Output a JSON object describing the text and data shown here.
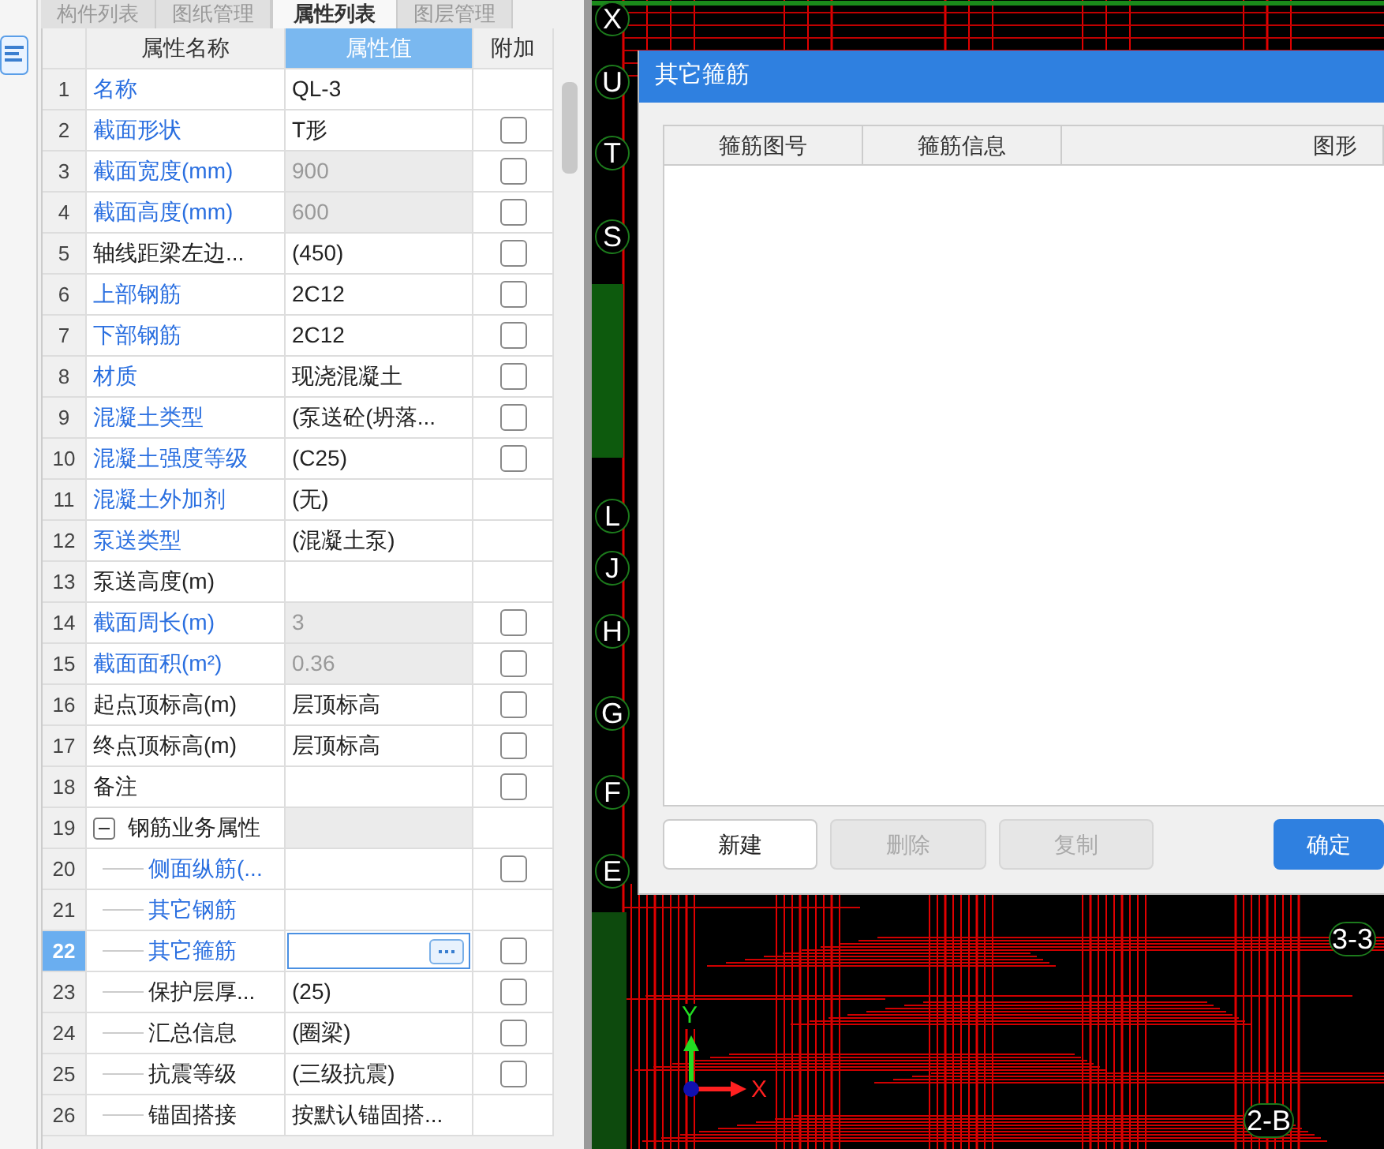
{
  "tabs": [
    {
      "label": "构件列表",
      "selected": false
    },
    {
      "label": "图纸管理",
      "selected": false
    },
    {
      "label": "属性列表",
      "selected": true
    },
    {
      "label": "图层管理",
      "selected": false
    }
  ],
  "property_table": {
    "columns": [
      "属性名称",
      "属性值",
      "附加"
    ],
    "rows": [
      {
        "num": "1",
        "name": "名称",
        "value": "QL-3",
        "link": true,
        "readonly": false,
        "selected": false
      },
      {
        "num": "2",
        "name": "截面形状",
        "value": "T形",
        "link": true,
        "readonly": false,
        "selected": false,
        "attached": false
      },
      {
        "num": "3",
        "name": "截面宽度(mm)",
        "value": "900",
        "link": true,
        "readonly": true,
        "selected": false,
        "attached": false
      },
      {
        "num": "4",
        "name": "截面高度(mm)",
        "value": "600",
        "link": true,
        "readonly": true,
        "selected": false,
        "attached": false
      },
      {
        "num": "5",
        "name": "轴线距梁左边...",
        "value": "(450)",
        "link": false,
        "readonly": false,
        "selected": false,
        "attached": false
      },
      {
        "num": "6",
        "name": "上部钢筋",
        "value": "2C12",
        "link": true,
        "readonly": false,
        "selected": false,
        "attached": false
      },
      {
        "num": "7",
        "name": "下部钢筋",
        "value": "2C12",
        "link": true,
        "readonly": false,
        "selected": false,
        "attached": false
      },
      {
        "num": "8",
        "name": "材质",
        "value": "现浇混凝土",
        "link": true,
        "readonly": false,
        "selected": false,
        "attached": false
      },
      {
        "num": "9",
        "name": "混凝土类型",
        "value": "(泵送砼(坍落...",
        "link": true,
        "readonly": false,
        "selected": false,
        "attached": false
      },
      {
        "num": "10",
        "name": "混凝土强度等级",
        "value": "(C25)",
        "link": true,
        "readonly": false,
        "selected": false,
        "attached": false
      },
      {
        "num": "11",
        "name": "混凝土外加剂",
        "value": "(无)",
        "link": true,
        "readonly": false,
        "selected": false
      },
      {
        "num": "12",
        "name": "泵送类型",
        "value": "(混凝土泵)",
        "link": true,
        "readonly": false,
        "selected": false
      },
      {
        "num": "13",
        "name": "泵送高度(m)",
        "link": false,
        "readonly": false,
        "selected": false
      },
      {
        "num": "14",
        "name": "截面周长(m)",
        "value": "3",
        "link": true,
        "readonly": true,
        "selected": false,
        "attached": false
      },
      {
        "num": "15",
        "name": "截面面积(m²)",
        "value": "0.36",
        "link": true,
        "readonly": true,
        "selected": false,
        "attached": false
      },
      {
        "num": "16",
        "name": "起点顶标高(m)",
        "value": "层顶标高",
        "link": false,
        "readonly": false,
        "selected": false,
        "attached": false
      },
      {
        "num": "17",
        "name": "终点顶标高(m)",
        "value": "层顶标高",
        "link": false,
        "readonly": false,
        "selected": false,
        "attached": false
      },
      {
        "num": "18",
        "name": "备注",
        "link": false,
        "readonly": false,
        "selected": false,
        "attached": false
      },
      {
        "num": "19",
        "name": "钢筋业务属性",
        "link": false,
        "selected": false,
        "expanded": true,
        "children": [
          {
            "num": "20",
            "name": "侧面纵筋(...",
            "link": true,
            "selected": false,
            "attached": false
          },
          {
            "num": "21",
            "name": "其它钢筋",
            "link": true,
            "selected": false
          },
          {
            "num": "22",
            "name": "其它箍筋",
            "link": true,
            "selected": true,
            "attached": false
          },
          {
            "num": "23",
            "name": "保护层厚...",
            "value": "(25)",
            "link": false,
            "selected": false,
            "attached": false
          },
          {
            "num": "24",
            "name": "汇总信息",
            "value": "(圈梁)",
            "link": false,
            "selected": false,
            "attached": false
          },
          {
            "num": "25",
            "name": "抗震等级",
            "value": "(三级抗震)",
            "link": false,
            "selected": false,
            "attached": false
          },
          {
            "num": "26",
            "name": "锚固搭接",
            "value": "按默认锚固搭...",
            "link": false,
            "selected": false
          }
        ]
      }
    ]
  },
  "canvas": {
    "axis_labels": [
      "X",
      "U",
      "T",
      "S",
      "L",
      "J",
      "H",
      "G",
      "F",
      "E",
      "3-3",
      "2-B"
    ],
    "axis_x": "X",
    "axis_y": "Y"
  },
  "dialog": {
    "title": "其它箍筋",
    "columns": [
      "箍筋图号",
      "箍筋信息",
      "图形"
    ],
    "buttons": [
      {
        "label": "新建",
        "kind": "normal",
        "disabled": false
      },
      {
        "label": "删除",
        "kind": "normal",
        "disabled": true
      },
      {
        "label": "复制",
        "kind": "normal",
        "disabled": true
      },
      {
        "label": "确定",
        "kind": "primary",
        "disabled": false
      }
    ]
  }
}
